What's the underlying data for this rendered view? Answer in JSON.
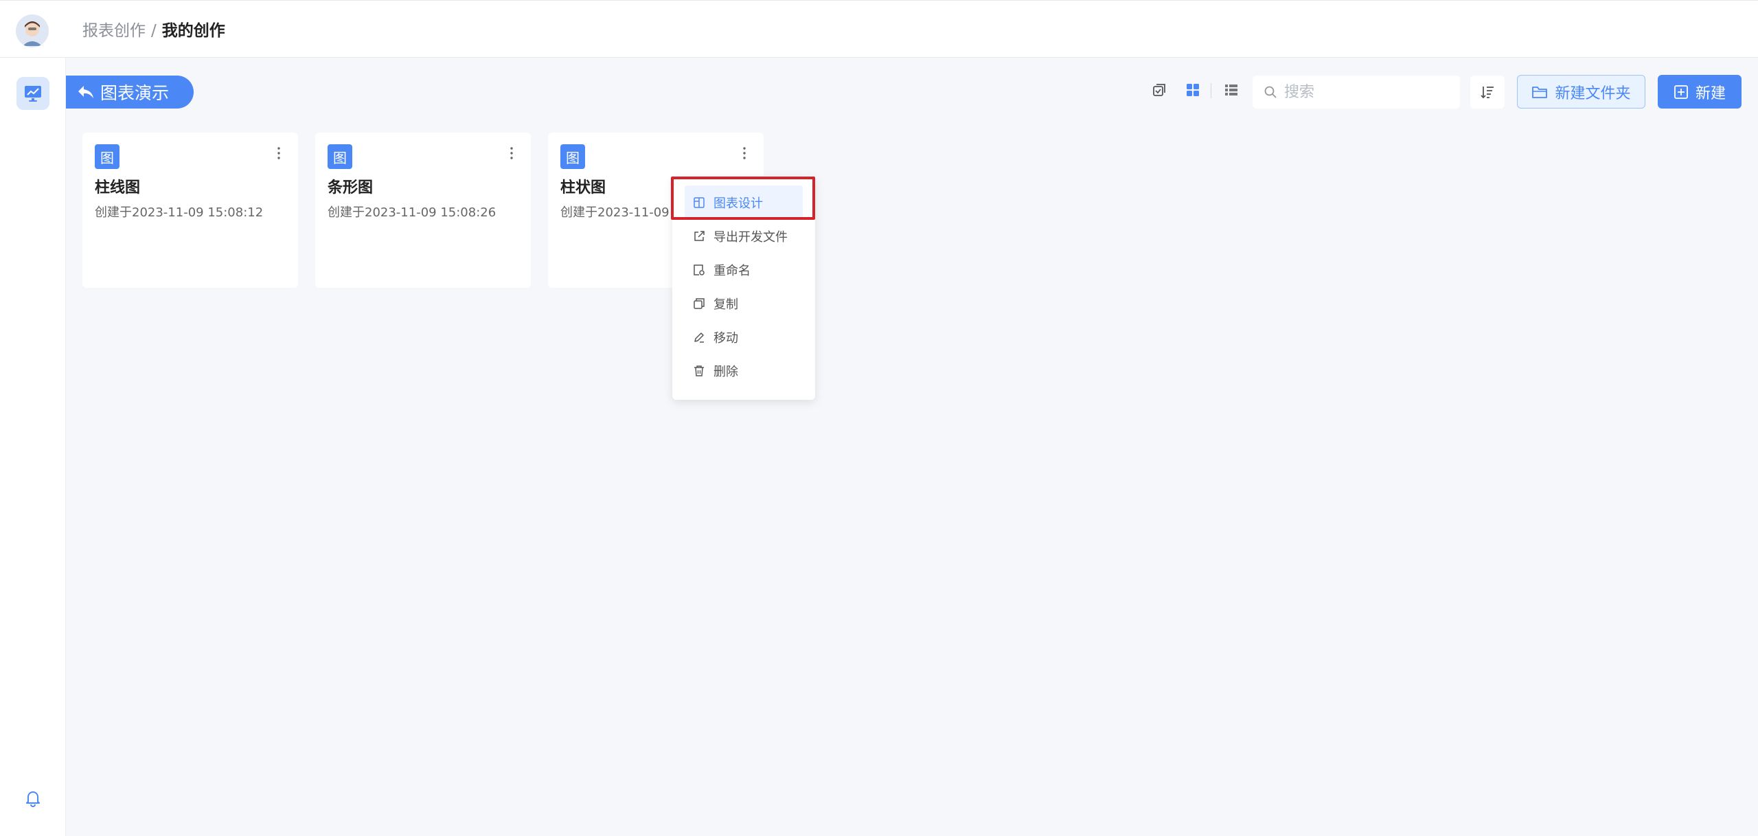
{
  "header": {
    "breadcrumb_parent": "报表创作",
    "breadcrumb_sep": "/",
    "breadcrumb_current": "我的创作"
  },
  "toolbar": {
    "back_label": "图表演示",
    "search_placeholder": "搜索",
    "new_folder_label": "新建文件夹",
    "new_label": "新建"
  },
  "cards": [
    {
      "badge": "图",
      "title": "柱线图",
      "date": "创建于2023-11-09 15:08:12"
    },
    {
      "badge": "图",
      "title": "条形图",
      "date": "创建于2023-11-09 15:08:26"
    },
    {
      "badge": "图",
      "title": "柱状图",
      "date": "创建于2023-11-09 1"
    }
  ],
  "menu": {
    "items": [
      {
        "label": "图表设计",
        "icon": "design-icon"
      },
      {
        "label": "导出开发文件",
        "icon": "export-icon"
      },
      {
        "label": "重命名",
        "icon": "rename-icon"
      },
      {
        "label": "复制",
        "icon": "copy-icon"
      },
      {
        "label": "移动",
        "icon": "move-icon"
      },
      {
        "label": "删除",
        "icon": "delete-icon"
      }
    ]
  },
  "colors": {
    "primary": "#4b88f5",
    "highlight": "#d4232b",
    "background": "#f5f7fb"
  }
}
